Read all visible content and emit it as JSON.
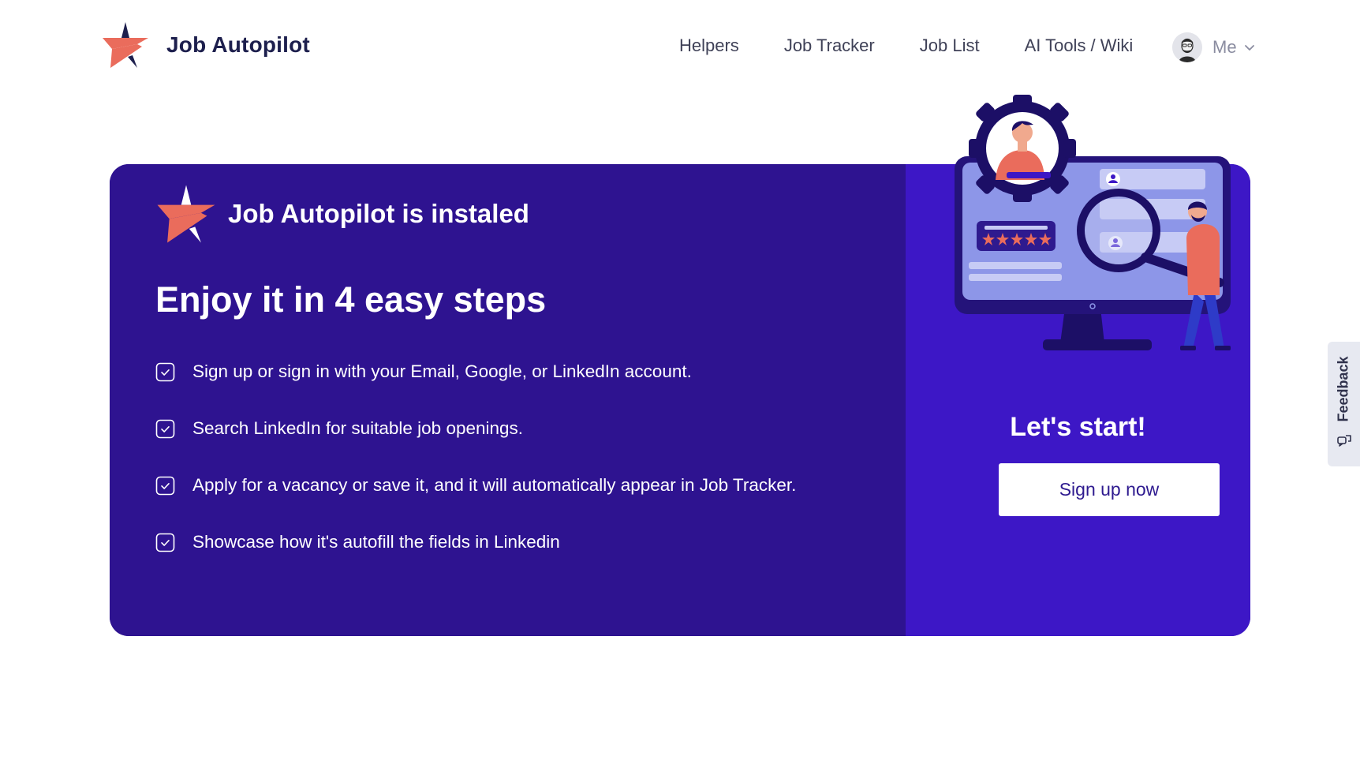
{
  "header": {
    "brand_name": "Job Autopilot",
    "nav": [
      {
        "label": "Helpers"
      },
      {
        "label": "Job Tracker"
      },
      {
        "label": "Job List"
      },
      {
        "label": "AI Tools / Wiki"
      }
    ],
    "user_label": "Me",
    "user_menu_icon": "chevron-down-icon"
  },
  "card": {
    "installed_title": "Job Autopilot is instaled",
    "steps_heading": "Enjoy it in 4 easy steps",
    "step_icon": "check-square-icon",
    "steps": [
      {
        "text": "Sign up or sign in with your Email, Google, or LinkedIn account."
      },
      {
        "text": "Search LinkedIn for suitable job openings."
      },
      {
        "text": "Apply for a vacancy or save it, and it will automatically appear in Job Tracker."
      },
      {
        "text": "Showcase how it's autofill the fields in Linkedin"
      }
    ],
    "cta_title": "Let's start!",
    "cta_button": "Sign up now",
    "illustration": "job-search-illustration",
    "colors": {
      "left_panel": "#2e1390",
      "right_panel": "#3d17c6",
      "accent": "#ea6c5c"
    }
  },
  "feedback": {
    "label": "Feedback",
    "icon": "feedback-icon"
  }
}
